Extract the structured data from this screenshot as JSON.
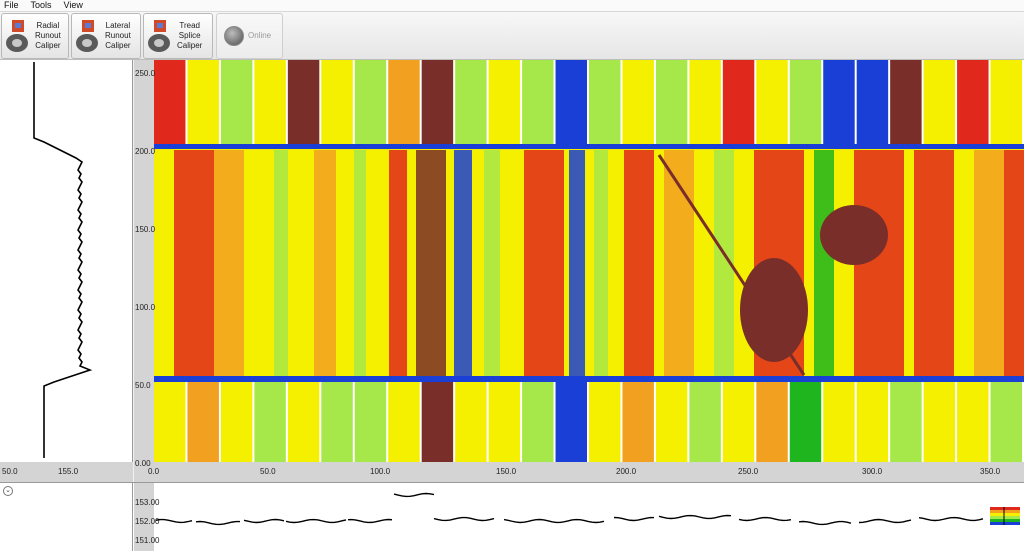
{
  "menu": {
    "items": [
      "File",
      "Tools",
      "View"
    ]
  },
  "toolbar": {
    "radial": "Radial\nRunout\nCaliper",
    "lateral": "Lateral\nRunout\nCaliper",
    "tread": "Tread\nSplice\nCaliper",
    "online": "Online"
  },
  "heatmap": {
    "y_ticks": [
      "0.00",
      "50.0",
      "100.0",
      "150.0",
      "200.0",
      "250.0"
    ],
    "x_ticks": [
      "0.0",
      "50.0",
      "100.0",
      "150.0",
      "200.0",
      "250.0",
      "300.0",
      "350.0"
    ]
  },
  "left_profile": {
    "x_ticks": [
      "50.0",
      "155.0"
    ]
  },
  "bottom_profile": {
    "y_ticks": [
      "153.00",
      "152.00",
      "151.00"
    ]
  },
  "colors": {
    "dark": "#7a2e2a",
    "red": "#e0281c",
    "orange": "#f2a020",
    "yellow": "#f4f000",
    "lime": "#a6e84a",
    "green": "#1fb51f",
    "blue": "#1a3fd6"
  }
}
